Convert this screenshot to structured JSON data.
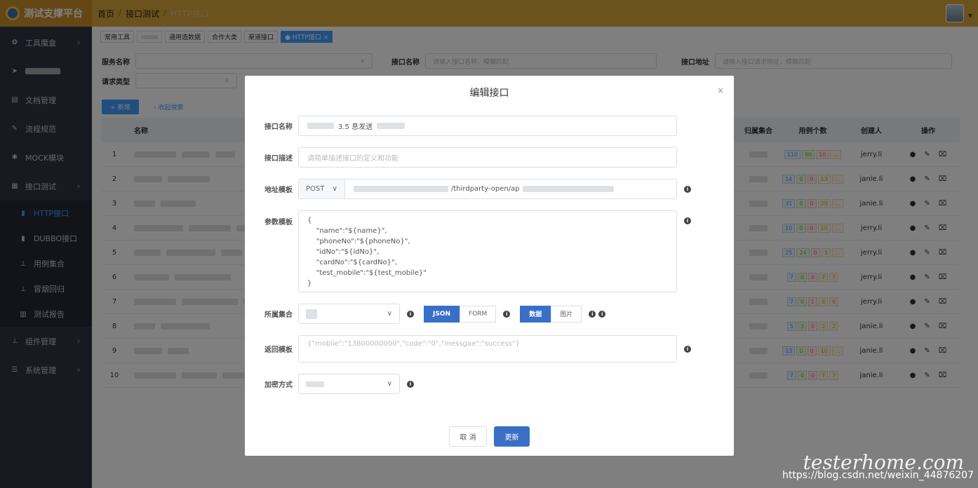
{
  "topbar": {
    "logo_text": "测试支撑平台",
    "breadcrumb": [
      "首页",
      "接口测试",
      "HTTP接口"
    ]
  },
  "sidebar": {
    "items": [
      {
        "icon": "gear-icon",
        "glyph": "✿",
        "label": "工具魔盒",
        "expandable": true
      },
      {
        "icon": "send-icon",
        "glyph": "➤",
        "label": "",
        "expandable": false
      },
      {
        "icon": "document-icon",
        "glyph": "▤",
        "label": "文档管理",
        "expandable": false
      },
      {
        "icon": "edit-icon",
        "glyph": "✎",
        "label": "流程规范",
        "expandable": false
      },
      {
        "icon": "asterisk-icon",
        "glyph": "✱",
        "label": "MOCK模块",
        "expandable": false
      },
      {
        "icon": "grid-icon",
        "glyph": "▦",
        "label": "接口测试",
        "expandable": true
      }
    ],
    "subitems": [
      {
        "icon": "server-icon",
        "glyph": "▮",
        "label": "HTTP接口",
        "active": true
      },
      {
        "icon": "server-icon",
        "glyph": "▮",
        "label": "DUBBO接口",
        "active": false
      },
      {
        "icon": "sitemap-icon",
        "glyph": "⊥",
        "label": "用例集合",
        "active": false
      },
      {
        "icon": "sitemap-icon",
        "glyph": "⊥",
        "label": "冒烟回归",
        "active": false
      },
      {
        "icon": "bar-chart-icon",
        "glyph": "▥",
        "label": "测试报告",
        "active": false
      }
    ],
    "bottom_items": [
      {
        "icon": "sitemap-icon",
        "glyph": "⊥",
        "label": "组件管理",
        "expandable": true
      },
      {
        "icon": "list-icon",
        "glyph": "☰",
        "label": "系统管理",
        "expandable": true
      }
    ]
  },
  "tabs": [
    "常用工具",
    "",
    "通用造数据",
    "合作大类",
    "渠道接口",
    "● HTTP接口 ×"
  ],
  "filters": {
    "service_label": "服务名称",
    "api_name_label": "接口名称",
    "api_name_placeholder": "请输入接口名称，模糊匹配",
    "api_addr_label": "接口地址",
    "api_addr_placeholder": "请输入接口请求地址，模糊匹配",
    "req_type_label": "请求类型"
  },
  "actions": {
    "add_label": "+ 新增",
    "collapse_label": "› 收起搜索"
  },
  "table": {
    "headers": {
      "name": "名称",
      "group": "归属集合",
      "count": "用例个数",
      "creator": "创建人",
      "ops": "操作"
    },
    "rows": [
      {
        "idx": "1",
        "counts": [
          "110",
          "90",
          "10",
          ""
        ],
        "creator": "jerry.li"
      },
      {
        "idx": "2",
        "counts": [
          "14",
          "0",
          "0",
          "13",
          ""
        ],
        "creator": "janie.li"
      },
      {
        "idx": "3",
        "counts": [
          "31",
          "0",
          "0",
          "29",
          ""
        ],
        "creator": "janie.li"
      },
      {
        "idx": "4",
        "counts": [
          "10",
          "0",
          "0",
          "10",
          ""
        ],
        "creator": "jerry.li"
      },
      {
        "idx": "5",
        "counts": [
          "25",
          "24",
          "0",
          "1",
          ""
        ],
        "creator": "jerry.li"
      },
      {
        "idx": "6",
        "counts": [
          "7",
          "0",
          "0",
          "7",
          "7"
        ],
        "creator": "jerry.li"
      },
      {
        "idx": "7",
        "counts": [
          "7",
          "0",
          "1",
          "6",
          "6"
        ],
        "creator": "jerry.li"
      },
      {
        "idx": "8",
        "counts": [
          "5",
          "3",
          "0",
          "2",
          "2"
        ],
        "creator": "janie.li"
      },
      {
        "idx": "9",
        "counts": [
          "13",
          "0",
          "0",
          "10",
          ""
        ],
        "creator": "janie.li"
      },
      {
        "idx": "10",
        "counts": [
          "7",
          "0",
          "0",
          "7",
          "7"
        ],
        "creator": "janie.li"
      }
    ]
  },
  "dialog": {
    "title": "编辑接口",
    "close": "×",
    "name_label": "接口名称",
    "name_value": "3.5 息发送",
    "desc_label": "接口描述",
    "desc_placeholder": "请简单描述接口的定义和功能",
    "addr_label": "地址模板",
    "method": "POST",
    "addr_value": "/thirdparty-open/ap",
    "param_label": "参数模板",
    "param_value": "{\n    \"name\":\"${name}\",\n    \"phoneNo\":\"${phoneNo}\",\n    \"idNo\":\"${idNo}\",\n    \"cardNo\":\"${cardNo}\",\n    \"test_mobile\":\"${test_mobile}\"\n}",
    "group_label": "所属集合",
    "format_options": [
      "JSON",
      "FORM"
    ],
    "data_options": [
      "数据",
      "图片"
    ],
    "return_label": "返回模板",
    "return_placeholder": "{\"mobile\":\"13800000000\",\"code\":\"0\",\"messgae\":\"success\"}",
    "encrypt_label": "加密方式",
    "cancel_label": "取 消",
    "update_label": "更新"
  },
  "watermark": {
    "url": "https://blog.csdn.net/weixin_44876207",
    "script": "testerhome.com"
  }
}
